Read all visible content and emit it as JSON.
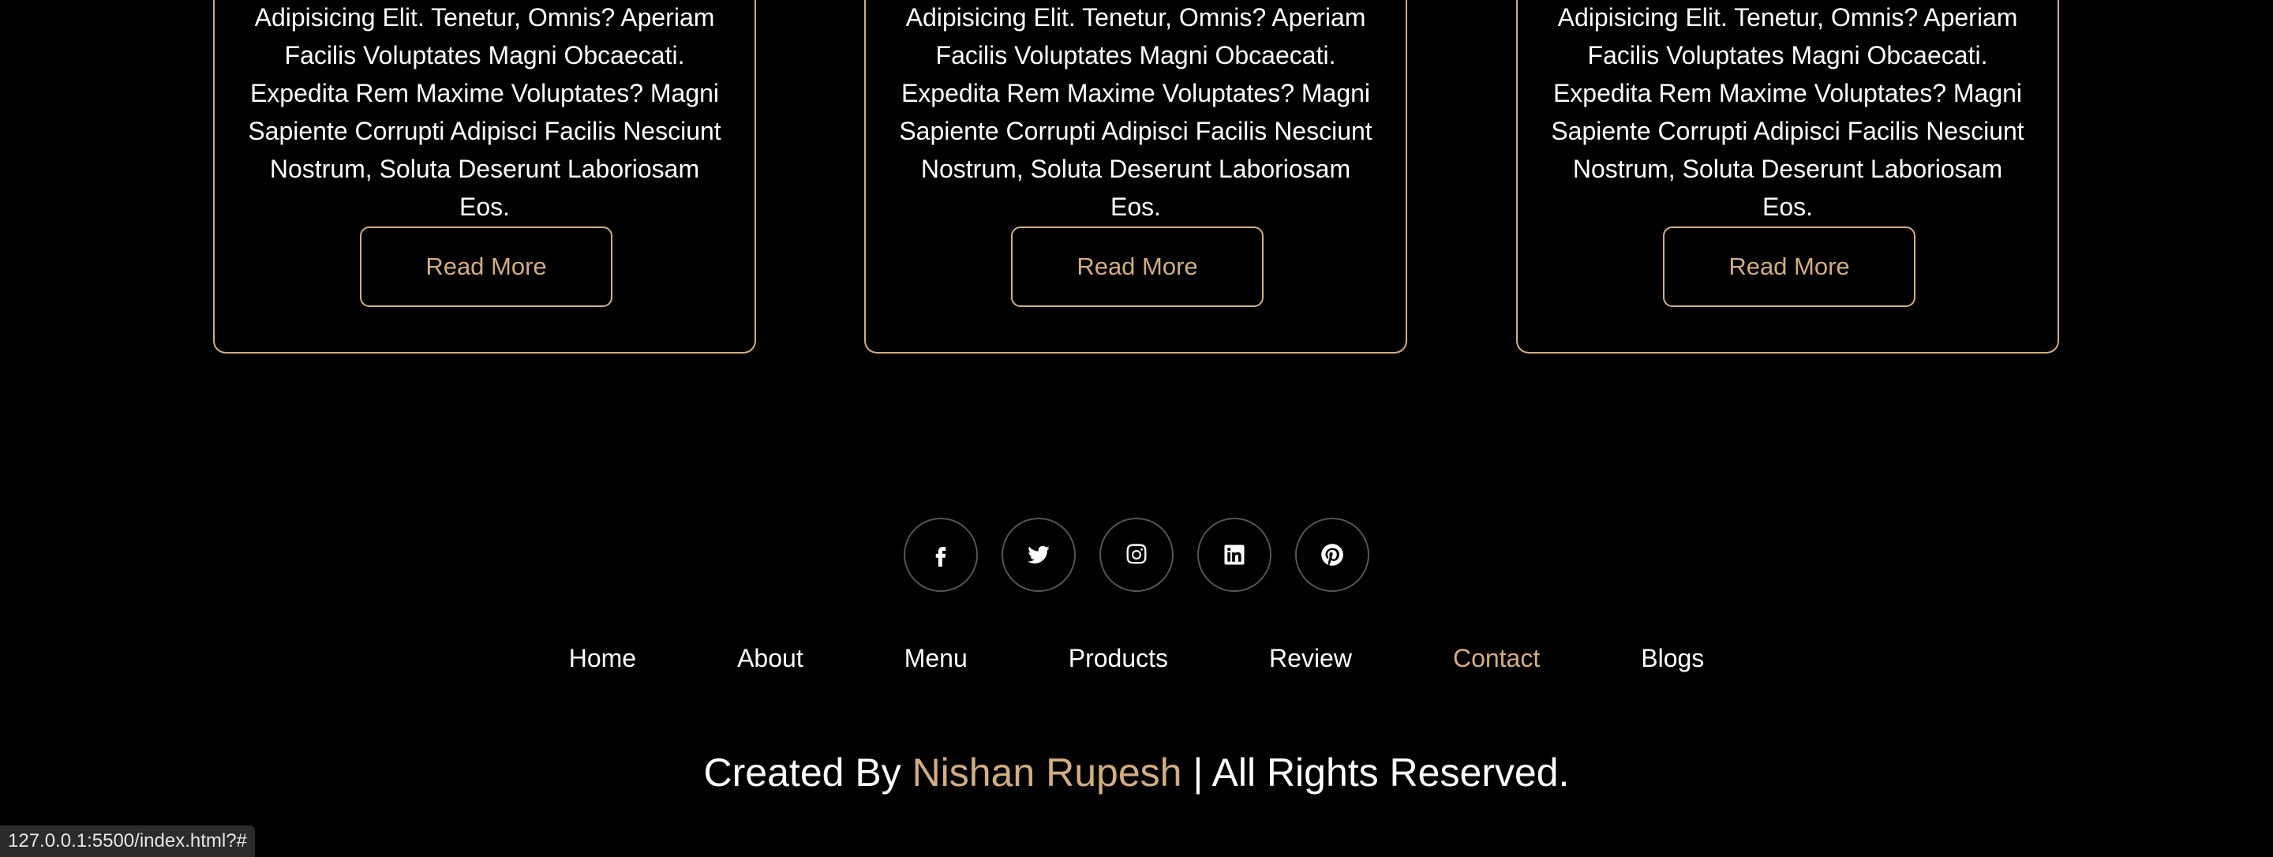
{
  "cards": [
    {
      "text": "Adipisicing Elit. Tenetur, Omnis? Aperiam Facilis Voluptates Magni Obcaecati. Expedita Rem Maxime Voluptates? Magni Sapiente Corrupti Adipisci Facilis Nesciunt Nostrum, Soluta Deserunt Laboriosam Eos.",
      "button": "Read More"
    },
    {
      "text": "Adipisicing Elit. Tenetur, Omnis? Aperiam Facilis Voluptates Magni Obcaecati. Expedita Rem Maxime Voluptates? Magni Sapiente Corrupti Adipisci Facilis Nesciunt Nostrum, Soluta Deserunt Laboriosam Eos.",
      "button": "Read More"
    },
    {
      "text": "Adipisicing Elit. Tenetur, Omnis? Aperiam Facilis Voluptates Magni Obcaecati. Expedita Rem Maxime Voluptates? Magni Sapiente Corrupti Adipisci Facilis Nesciunt Nostrum, Soluta Deserunt Laboriosam Eos.",
      "button": "Read More"
    }
  ],
  "footer": {
    "social_icons": [
      "facebook-icon",
      "twitter-icon",
      "instagram-icon",
      "linkedin-icon",
      "pinterest-icon"
    ],
    "links": [
      "Home",
      "About",
      "Menu",
      "Products",
      "Review",
      "Contact",
      "Blogs"
    ],
    "active_link": "Contact",
    "credit_prefix": "Created By",
    "credit_name": "Nishan Rupesh",
    "credit_suffix": "| All Rights Reserved."
  },
  "status_bar": {
    "url": "127.0.0.1:5500/index.html?#"
  },
  "colors": {
    "background": "#000000",
    "accent": "#d3ad7f",
    "text": "#ffffff"
  }
}
